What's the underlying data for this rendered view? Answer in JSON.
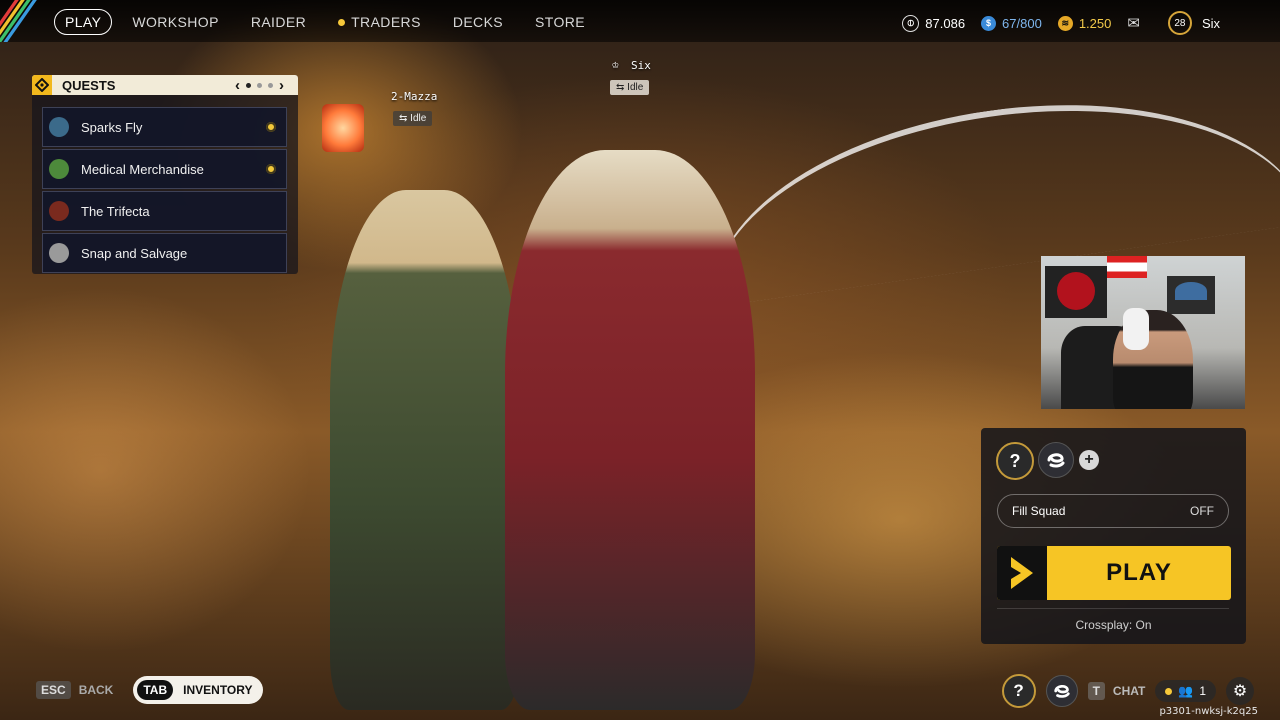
{
  "topbar": {
    "nav": [
      {
        "label": "PLAY",
        "active": true
      },
      {
        "label": "WORKSHOP"
      },
      {
        "label": "RAIDER"
      },
      {
        "label": "TRADERS",
        "indicator": true
      },
      {
        "label": "DECKS"
      },
      {
        "label": "STORE"
      }
    ],
    "currency_coins": "87.086",
    "raider_tokens": "67/800",
    "cred": "1.250",
    "level": "28",
    "username": "Six"
  },
  "quests": {
    "title": "QUESTS",
    "page_prev": "‹",
    "page_next": "›",
    "current_page": 1,
    "total_pages": 3,
    "items": [
      {
        "label": "Sparks Fly",
        "tracked": true,
        "color": "#3b6a8a"
      },
      {
        "label": "Medical Merchandise",
        "tracked": true,
        "color": "#4d8a3b"
      },
      {
        "label": "The Trifecta",
        "tracked": false,
        "color": "#7a2a1e"
      },
      {
        "label": "Snap and Salvage",
        "tracked": false,
        "color": "#9a9a9a"
      }
    ]
  },
  "players": [
    {
      "name": "Six",
      "status": "Idle"
    },
    {
      "name": "2-Mazza",
      "status": "Idle"
    }
  ],
  "squad": {
    "fill_label": "Fill Squad",
    "fill_value": "OFF",
    "play_label": "PLAY",
    "crossplay": "Crossplay: On",
    "add": "+"
  },
  "bottom": {
    "back_key": "ESC",
    "back_label": "BACK",
    "inventory_key": "TAB",
    "inventory_label": "INVENTORY",
    "chat_key": "T",
    "chat_label": "CHAT",
    "friends_count": "1"
  },
  "watermark": "p3301-nwksj-k2q25",
  "colors": {
    "accent": "#f6c525",
    "panel": "#16161a"
  }
}
